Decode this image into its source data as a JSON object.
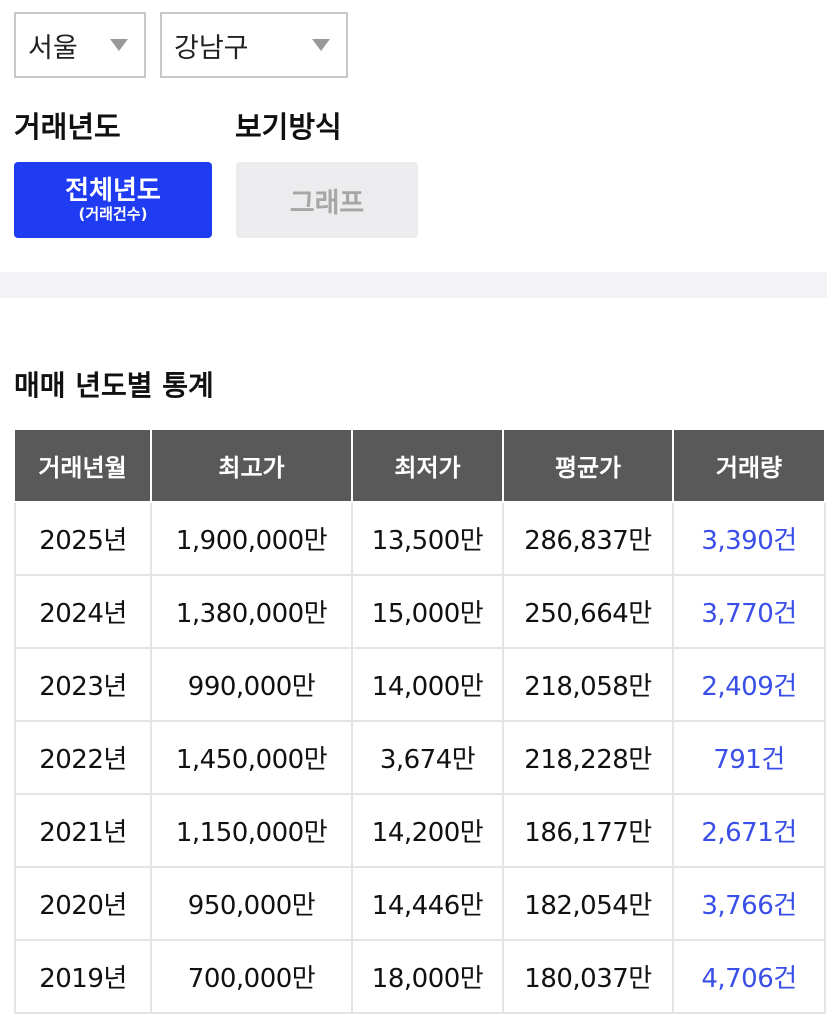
{
  "filters": {
    "region": "서울",
    "district": "강남구"
  },
  "labels": {
    "year": "거래년도",
    "view": "보기방식"
  },
  "buttons": {
    "all_years_main": "전체년도",
    "all_years_sub": "(거래건수)",
    "graph": "그래프"
  },
  "section_title": "매매 년도별 통계",
  "table": {
    "headers": [
      "거래년월",
      "최고가",
      "최저가",
      "평균가",
      "거래량"
    ],
    "rows": [
      [
        "2025년",
        "1,900,000만",
        "13,500만",
        "286,837만",
        "3,390건"
      ],
      [
        "2024년",
        "1,380,000만",
        "15,000만",
        "250,664만",
        "3,770건"
      ],
      [
        "2023년",
        "990,000만",
        "14,000만",
        "218,058만",
        "2,409건"
      ],
      [
        "2022년",
        "1,450,000만",
        "3,674만",
        "218,228만",
        "791건"
      ],
      [
        "2021년",
        "1,150,000만",
        "14,200만",
        "186,177만",
        "2,671건"
      ],
      [
        "2020년",
        "950,000만",
        "14,446만",
        "182,054만",
        "3,766건"
      ],
      [
        "2019년",
        "700,000만",
        "18,000만",
        "180,037만",
        "4,706건"
      ]
    ]
  },
  "colors": {
    "primary_button": "#1f3cf2",
    "header_bg": "#595959",
    "count_link": "#3a4fe8"
  }
}
